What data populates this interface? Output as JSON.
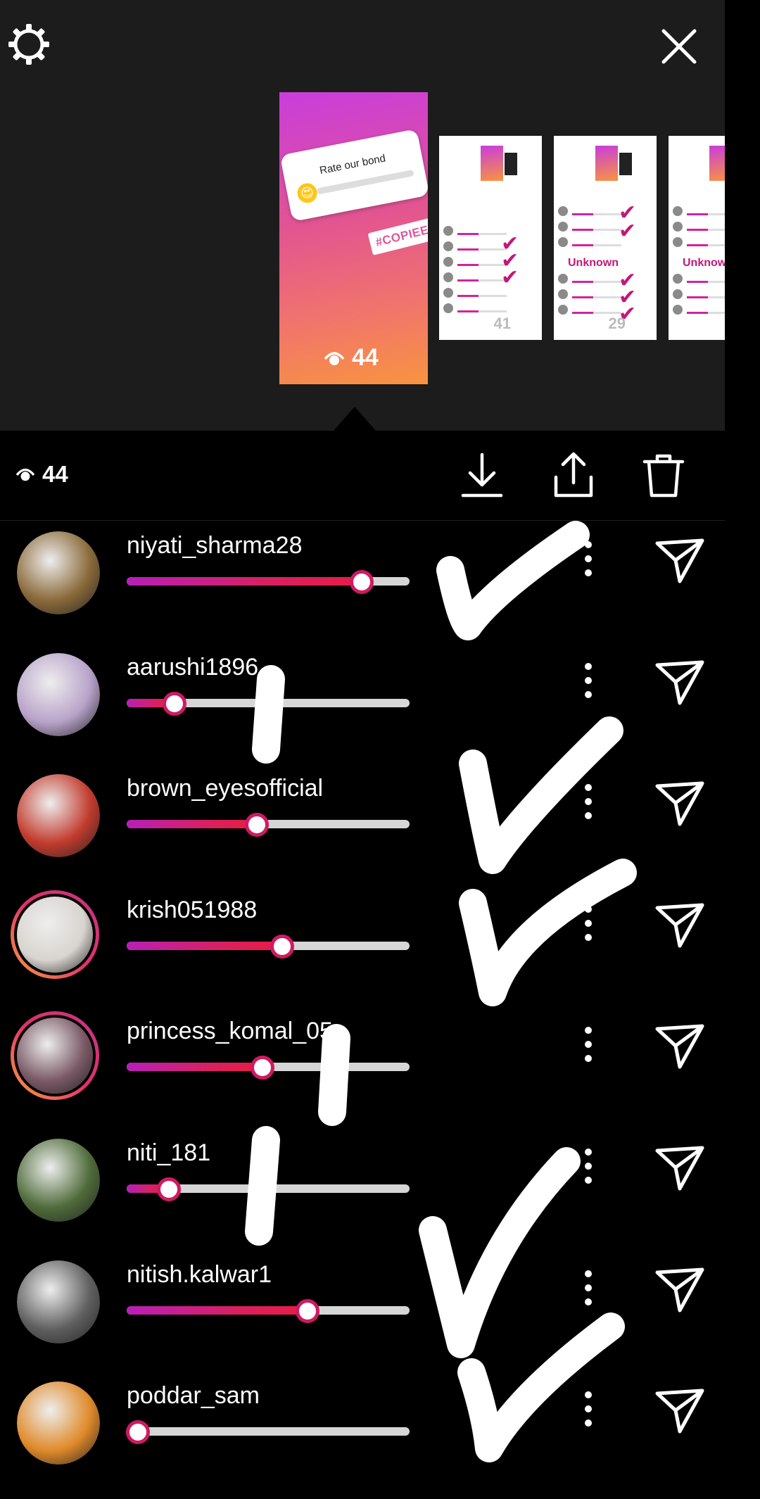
{
  "story": {
    "sticker_question": "Rate our bond",
    "sticker_emoji": "😍",
    "tag": "#COPIEE",
    "views": "44"
  },
  "thumbnails": [
    {
      "views": "41",
      "marks": [
        "✔",
        "✔",
        "✔"
      ],
      "unknown": ""
    },
    {
      "views": "29",
      "marks": [
        "✔",
        "✔",
        "✔",
        "✔",
        "✔"
      ],
      "unknown": "Unknown"
    },
    {
      "views": "",
      "marks": [],
      "unknown": "Unknow"
    }
  ],
  "toolbar": {
    "views": "44",
    "icons": [
      "eye-icon",
      "download-icon",
      "share-icon",
      "trash-icon"
    ]
  },
  "header_icons": [
    "gear-icon",
    "close-icon"
  ],
  "viewers": [
    {
      "username": "niyati_sharma28",
      "rating": 0.83,
      "avatar_color": "#8a6a3a",
      "ring": false
    },
    {
      "username": "aarushi1896",
      "rating": 0.17,
      "avatar_color": "#b8a3c9",
      "ring": false
    },
    {
      "username": "brown_eyesofficial",
      "rating": 0.46,
      "avatar_color": "#c23b2e",
      "ring": false
    },
    {
      "username": "krish051988",
      "rating": 0.55,
      "avatar_color": "#d8d4cf",
      "ring": true
    },
    {
      "username": "princess_komal_05",
      "rating": 0.48,
      "avatar_color": "#7a5a66",
      "ring": true
    },
    {
      "username": "niti_181",
      "rating": 0.15,
      "avatar_color": "#4f6b3a",
      "ring": false
    },
    {
      "username": "nitish.kalwar1",
      "rating": 0.64,
      "avatar_color": "#5f5f5f",
      "ring": false
    },
    {
      "username": "poddar_sam",
      "rating": 0.04,
      "avatar_color": "#e08a2a",
      "ring": false
    }
  ],
  "colors": {
    "background": "#000000",
    "strip": "#1c1c1c",
    "slider_track": "#d6d6d6",
    "slider_accent": "#d82062",
    "annotation": "#ffffff"
  }
}
